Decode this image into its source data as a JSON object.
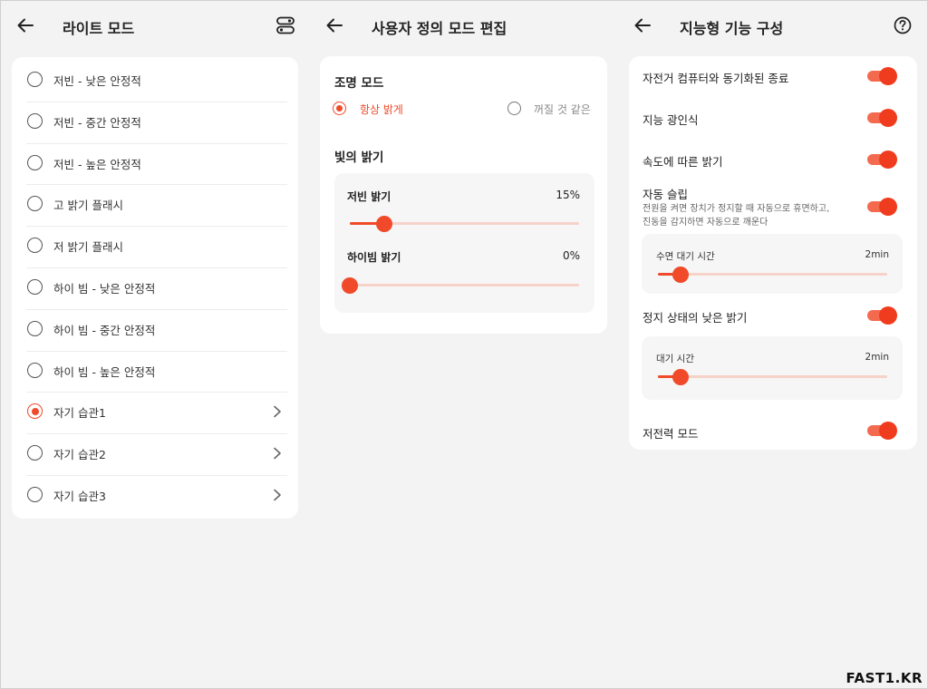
{
  "left_panel": {
    "title": "라이트 모드",
    "items": [
      {
        "label": "저빈 - 낮은 안정적",
        "selected": false,
        "chevron": false
      },
      {
        "label": "저빈 - 중간 안정적",
        "selected": false,
        "chevron": false
      },
      {
        "label": "저빈 - 높은 안정적",
        "selected": false,
        "chevron": false
      },
      {
        "label": "고 밝기 플래시",
        "selected": false,
        "chevron": false
      },
      {
        "label": "저 밝기 플래시",
        "selected": false,
        "chevron": false
      },
      {
        "label": "하이 빔 - 낮은 안정적",
        "selected": false,
        "chevron": false
      },
      {
        "label": "하이 빔 - 중간 안정적",
        "selected": false,
        "chevron": false
      },
      {
        "label": "하이 빔 - 높은 안정적",
        "selected": false,
        "chevron": false
      },
      {
        "label": "자기 습관1",
        "selected": true,
        "chevron": true
      },
      {
        "label": "자기 습관2",
        "selected": false,
        "chevron": true
      },
      {
        "label": "자기 습관3",
        "selected": false,
        "chevron": true
      }
    ]
  },
  "middle_panel": {
    "title": "사용자 정의 모드 편집",
    "lighting_mode": {
      "title": "조명 모드",
      "options": [
        {
          "label": "항상 밝게",
          "selected": true
        },
        {
          "label": "꺼질 것 같은",
          "selected": false
        }
      ]
    },
    "brightness": {
      "title": "빛의 밝기",
      "sliders": [
        {
          "label": "저빈 밝기",
          "value_text": "15%",
          "value": 0.15
        },
        {
          "label": "하이빔 밝기",
          "value_text": "0%",
          "value": 0.0
        }
      ]
    }
  },
  "right_panel": {
    "title": "지능형 기능 구성",
    "settings": {
      "sync_off": {
        "label": "자전거 컴퓨터와 동기화된 종료",
        "on": true
      },
      "light_sense": {
        "label": "지능 광인식",
        "on": true
      },
      "speed_brightness": {
        "label": "속도에 따른 밝기",
        "on": true
      },
      "auto_sleep": {
        "label": "자동 슬립",
        "description_line1": "전원을 켜면 장치가 정지할 때 자동으로 휴면하고,",
        "description_line2": "진동을 감지하면 자동으로 깨운다",
        "on": true,
        "timer_label": "수면 대기 시간",
        "timer_value": "2min",
        "timer_fraction": 0.1
      },
      "standstill_low": {
        "label": "정지 상태의 낮은 밝기",
        "on": true,
        "timer_label": "대기 시간",
        "timer_value": "2min",
        "timer_fraction": 0.1
      },
      "power_save": {
        "label": "저전력 모드",
        "on": true
      }
    }
  },
  "watermark": "FAST1.KR",
  "colors": {
    "accent": "#f04a2a",
    "track": "#f6d2c9",
    "background": "#f3f3f3"
  },
  "icons": {
    "back": "arrow-left-icon",
    "settings": "toggle-settings-icon",
    "help": "question-circle-icon",
    "chevron": "chevron-right-icon"
  }
}
